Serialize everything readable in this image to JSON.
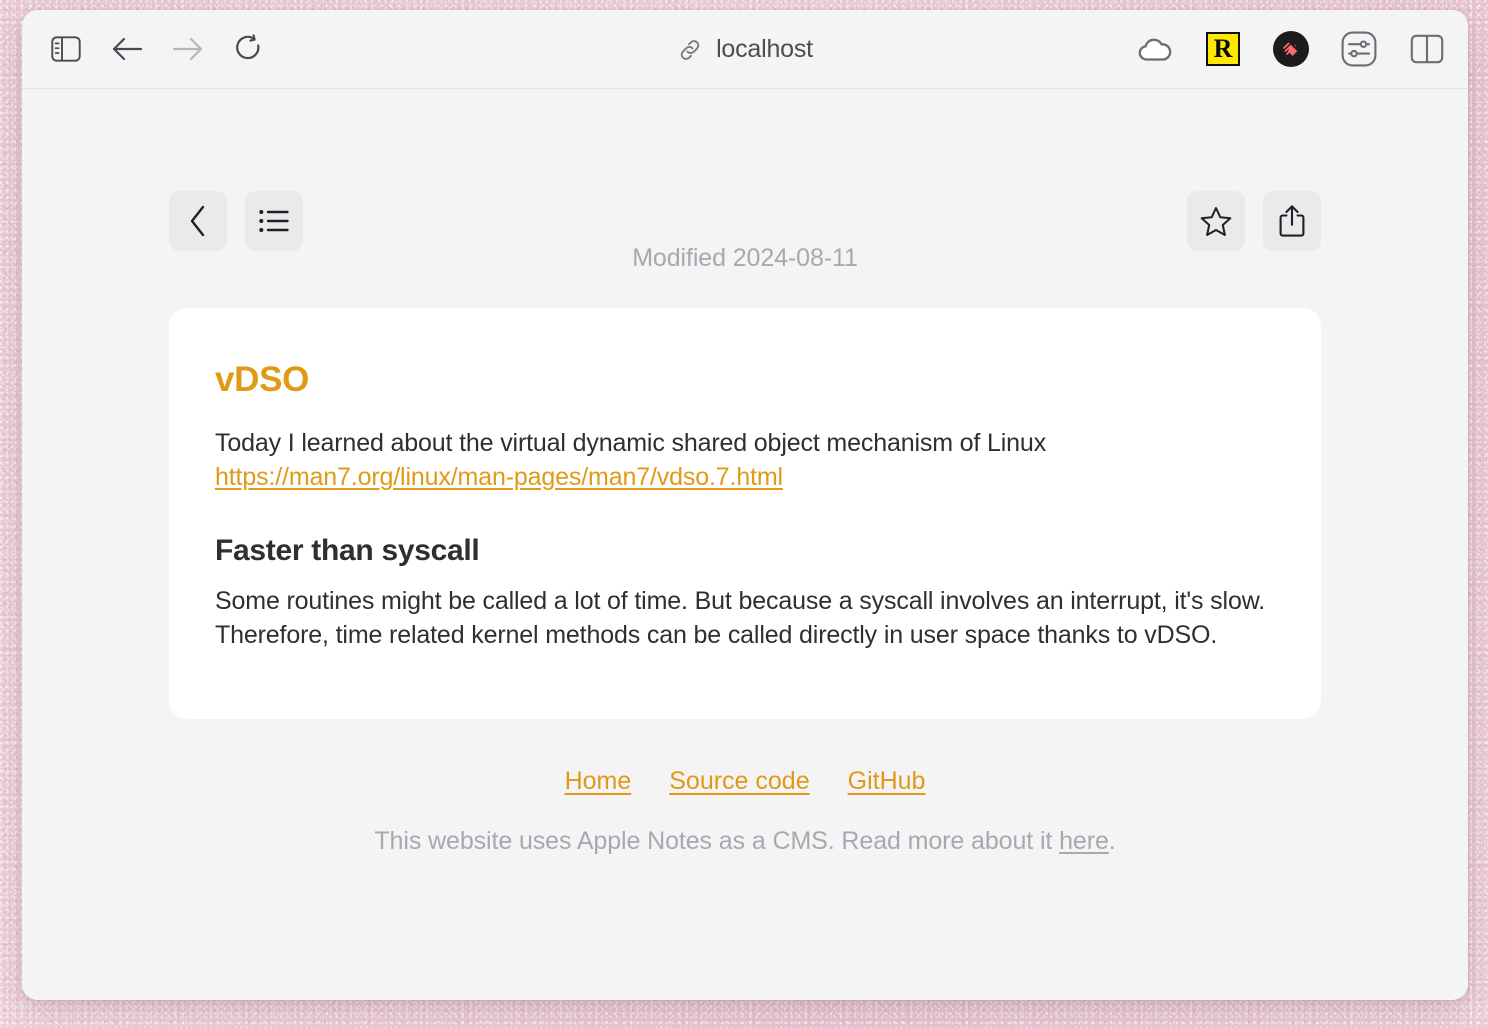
{
  "window": {
    "toolbar": {
      "sidebar_toggle_label": "Show sidebar",
      "back_label": "Back",
      "forward_label": "Forward",
      "reload_label": "Reload",
      "address_text": "localhost",
      "address_icon": "link-icon",
      "extensions": [
        {
          "name": "icloud-extension",
          "icon": "cloud-icon",
          "label": "iCloud"
        },
        {
          "name": "raindrop-extension",
          "icon": "r-badge-icon",
          "label": "R"
        },
        {
          "name": "adblock-extension",
          "icon": "dark-circle-icon",
          "label": "Ad blocker"
        },
        {
          "name": "settings-extension",
          "icon": "sliders-icon",
          "label": "Settings"
        },
        {
          "name": "split-view",
          "icon": "split-view-icon",
          "label": "Split view"
        }
      ]
    }
  },
  "page": {
    "actions": {
      "back_icon": "chevron-left-icon",
      "back_label": "Back",
      "list_icon": "bulleted-list-icon",
      "list_label": "All notes",
      "favorite_icon": "star-icon",
      "favorite_label": "Favorite",
      "share_icon": "share-icon",
      "share_label": "Share"
    },
    "modified": "Modified 2024-08-11",
    "note": {
      "title": "vDSO",
      "paragraph_1": "Today I learned about the virtual dynamic shared object mechanism of Linux",
      "link_text": "https://man7.org/linux/man-pages/man7/vdso.7.html",
      "subheading": "Faster than syscall",
      "paragraph_2": "Some routines might be called a lot of time. But because a syscall involves an interrupt, it's slow. Therefore, time related kernel methods can be called directly in user space thanks to vDSO."
    },
    "footer": {
      "links": [
        {
          "label": "Home",
          "name": "footer-link-home"
        },
        {
          "label": "Source code",
          "name": "footer-link-source-code"
        },
        {
          "label": "GitHub",
          "name": "footer-link-github"
        }
      ],
      "note_prefix": "This website uses Apple Notes as a CMS. Read more about it ",
      "note_link": "here",
      "note_suffix": "."
    }
  },
  "colors": {
    "accent": "#e09a15",
    "text": "#2f2f33",
    "muted": "#a9a9ad",
    "window_bg": "#f4f4f6",
    "card_bg": "#ffffff",
    "desktop": "#e7c9d2"
  }
}
